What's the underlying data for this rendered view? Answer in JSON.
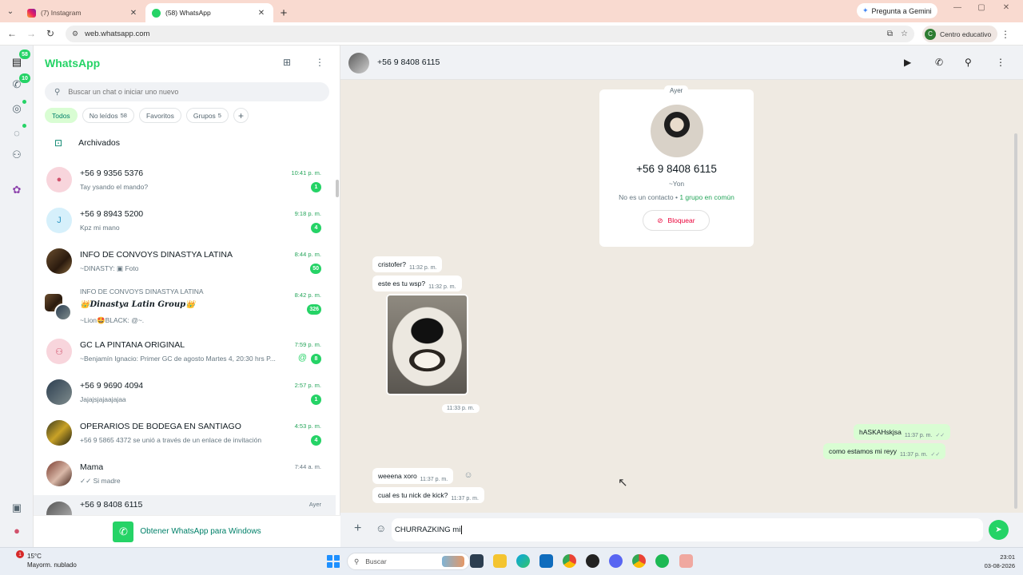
{
  "browser": {
    "tabs": [
      {
        "title": "(7) Instagram",
        "active": false
      },
      {
        "title": "(58) WhatsApp",
        "active": true
      }
    ],
    "gemini_label": "Pregunta a Gemini",
    "url": "web.whatsapp.com",
    "profile_initial": "C",
    "profile_label": "Centro educativo"
  },
  "rail": {
    "chats_badge": "58",
    "calls_badge": "10"
  },
  "sidebar": {
    "title": "WhatsApp",
    "search_placeholder": "Buscar un chat o iniciar uno nuevo",
    "filters": [
      {
        "label": "Todos",
        "count": ""
      },
      {
        "label": "No leídos",
        "count": "58"
      },
      {
        "label": "Favoritos",
        "count": ""
      },
      {
        "label": "Grupos",
        "count": "5"
      }
    ],
    "archived_label": "Archivados",
    "chats": [
      {
        "initial": "",
        "name": "+56 9 9356 5376",
        "preview": "Tay ysando el mando?",
        "time": "10:41 p. m.",
        "unread": "1"
      },
      {
        "initial": "J",
        "name": "+56 9 8943 5200",
        "preview": "Kpz mi mano",
        "time": "9:18 p. m.",
        "unread": "4"
      },
      {
        "initial": "",
        "name": "INFO DE CONVOYS DINASTYA LATINA",
        "preview": "~DINASTY: ▣ Foto",
        "time": "8:44 p. m.",
        "unread": "50"
      },
      {
        "initial": "",
        "community": "INFO DE CONVOYS DINASTYA LATINA",
        "name": "👑𝑫𝒊𝒏𝒂𝒔𝒕𝒚𝒂 𝑳𝒂𝒕𝒊𝒏 𝑮𝒓𝒐𝒖𝒑👑",
        "preview": "~Lion🤩BLACK: @~.",
        "time": "8:42 p. m.",
        "unread": "326"
      },
      {
        "initial": "",
        "name": "GC LA PINTANA ORIGINAL",
        "preview": "~Benjamín Ignacio: Primer GC de agosto Martes 4, 20:30 hrs P...",
        "time": "7:59 p. m.",
        "unread": "8"
      },
      {
        "initial": "",
        "name": "+56 9 9690 4094",
        "preview": "Jajajsjajaajajaa",
        "time": "2:57 p. m.",
        "unread": "1"
      },
      {
        "initial": "",
        "name": "OPERARIOS DE BODEGA EN SANTIAGO",
        "preview": "+56 9 5865 4372 se unió a través de un enlace de invitación",
        "time": "4:53 p. m.",
        "unread": "4"
      },
      {
        "initial": "",
        "name": "Mama",
        "preview": "✓✓ Si madre",
        "time": "7:44 a. m.",
        "unread": ""
      },
      {
        "initial": "",
        "name": "+56 9 8408 6115",
        "preview": "",
        "time": "Ayer",
        "unread": ""
      }
    ],
    "footer_link": "Obtener WhatsApp para Windows"
  },
  "conversation": {
    "contact_name": "+56 9 8408 6115",
    "day_label": "Ayer",
    "card": {
      "number": "+56 9 8408 6115",
      "push_name": "~Yon",
      "info_prefix": "No es un contacto • ",
      "info_groups": "1 grupo en común",
      "block_label": "Bloquear"
    },
    "messages": [
      {
        "dir": "in",
        "text": "cristofer?",
        "time": "11:32 p. m."
      },
      {
        "dir": "in",
        "text": "este es tu wsp?",
        "time": "11:32 p. m."
      },
      {
        "dir": "in",
        "text": "",
        "time": "11:33 p. m."
      },
      {
        "dir": "out",
        "text": "hASKAHskjsa",
        "time": "11:37 p. m."
      },
      {
        "dir": "out",
        "text": "como estamos mi reyy",
        "time": "11:37 p. m."
      },
      {
        "dir": "in",
        "text": "weeena xoro",
        "time": "11:37 p. m."
      },
      {
        "dir": "in",
        "text": "cual es tu nick de kick?",
        "time": "11:37 p. m."
      }
    ],
    "composer_text": "CHURRAZKING mi"
  },
  "taskbar": {
    "weather_badge": "1",
    "temperature": "15°C",
    "weather_desc": "Mayorm. nublado",
    "search_placeholder": "Buscar",
    "time": "23:01",
    "date": "03-08-2026"
  },
  "colors": {
    "accent": "#25d366",
    "accent_dark": "#008069",
    "outgoing_bubble": "#d9fdd3",
    "chat_background": "#efeae2",
    "tab_strip": "#f9dad0"
  }
}
